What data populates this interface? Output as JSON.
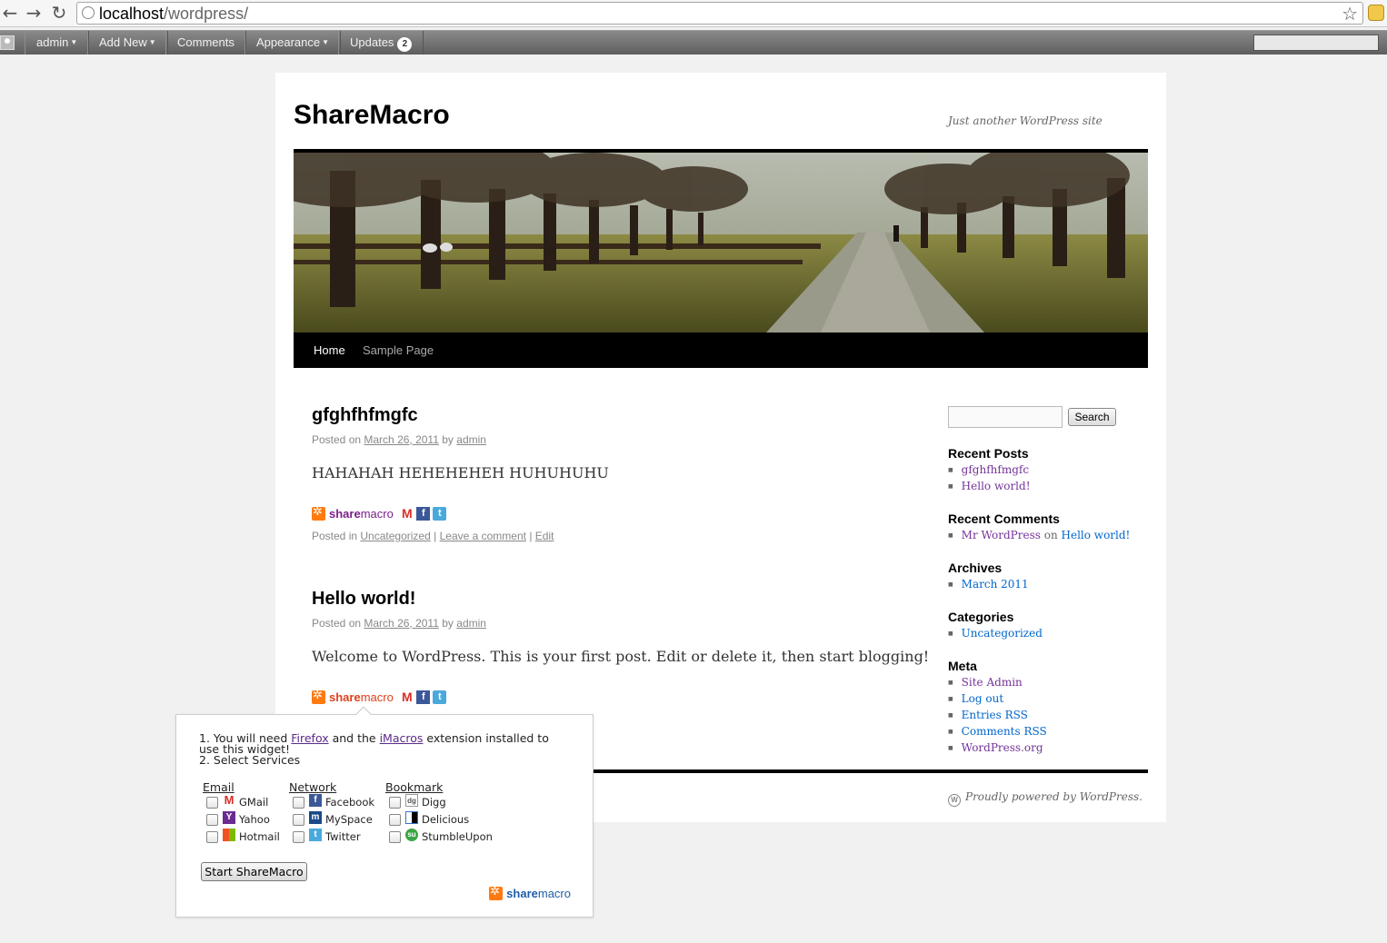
{
  "browser": {
    "url_host": "localhost",
    "url_path": "/wordpress/"
  },
  "admin_bar": {
    "user": "admin",
    "add_new": "Add New",
    "comments": "Comments",
    "appearance": "Appearance",
    "updates": "Updates",
    "updates_count": "2"
  },
  "site": {
    "title": "ShareMacro",
    "description": "Just another WordPress site"
  },
  "nav": {
    "items": [
      "Home",
      "Sample Page"
    ]
  },
  "posts": [
    {
      "title": "gfghfhfmgfc",
      "meta_prefix": "Posted on",
      "date": "March 26, 2011",
      "by": "by",
      "author": "admin",
      "content": "HAHAHAH HEHEHEHEH HUHUHUHU",
      "posted_in": "Posted in",
      "category": "Uncategorized",
      "sep": "|",
      "comment_link": "Leave a comment",
      "edit": "Edit"
    },
    {
      "title": "Hello world!",
      "meta_prefix": "Posted on",
      "date": "March 26, 2011",
      "by": "by",
      "author": "admin",
      "content": "Welcome to WordPress. This is your first post. Edit or delete it, then start blogging!"
    }
  ],
  "sharemacro": {
    "word_pre": "share",
    "word_post": "macro"
  },
  "sidebar": {
    "search_button": "Search",
    "recent_posts_title": "Recent Posts",
    "recent_posts": [
      "gfghfhfmgfc",
      "Hello world!"
    ],
    "recent_comments_title": "Recent Comments",
    "recent_comment_author": "Mr WordPress",
    "recent_comment_on": "on",
    "recent_comment_post": "Hello world!",
    "archives_title": "Archives",
    "archives": [
      "March 2011"
    ],
    "categories_title": "Categories",
    "categories": [
      "Uncategorized"
    ],
    "meta_title": "Meta",
    "meta": [
      "Site Admin",
      "Log out",
      "Entries RSS",
      "Comments RSS",
      "WordPress.org"
    ]
  },
  "footer": {
    "powered": "Proudly powered by WordPress."
  },
  "popup": {
    "line1_a": "1. You will need ",
    "firefox": "Firefox",
    "line1_b": " and the ",
    "imacros": "iMacros",
    "line1_c": " extension installed to use this widget!",
    "line2": "2. Select Services",
    "email_head": "Email",
    "network_head": "Network",
    "bookmark_head": "Bookmark",
    "email": [
      "GMail",
      "Yahoo",
      "Hotmail"
    ],
    "network": [
      "Facebook",
      "MySpace",
      "Twitter"
    ],
    "bookmark": [
      "Digg",
      "Delicious",
      "StumbleUpon"
    ],
    "start_button": "Start ShareMacro"
  }
}
